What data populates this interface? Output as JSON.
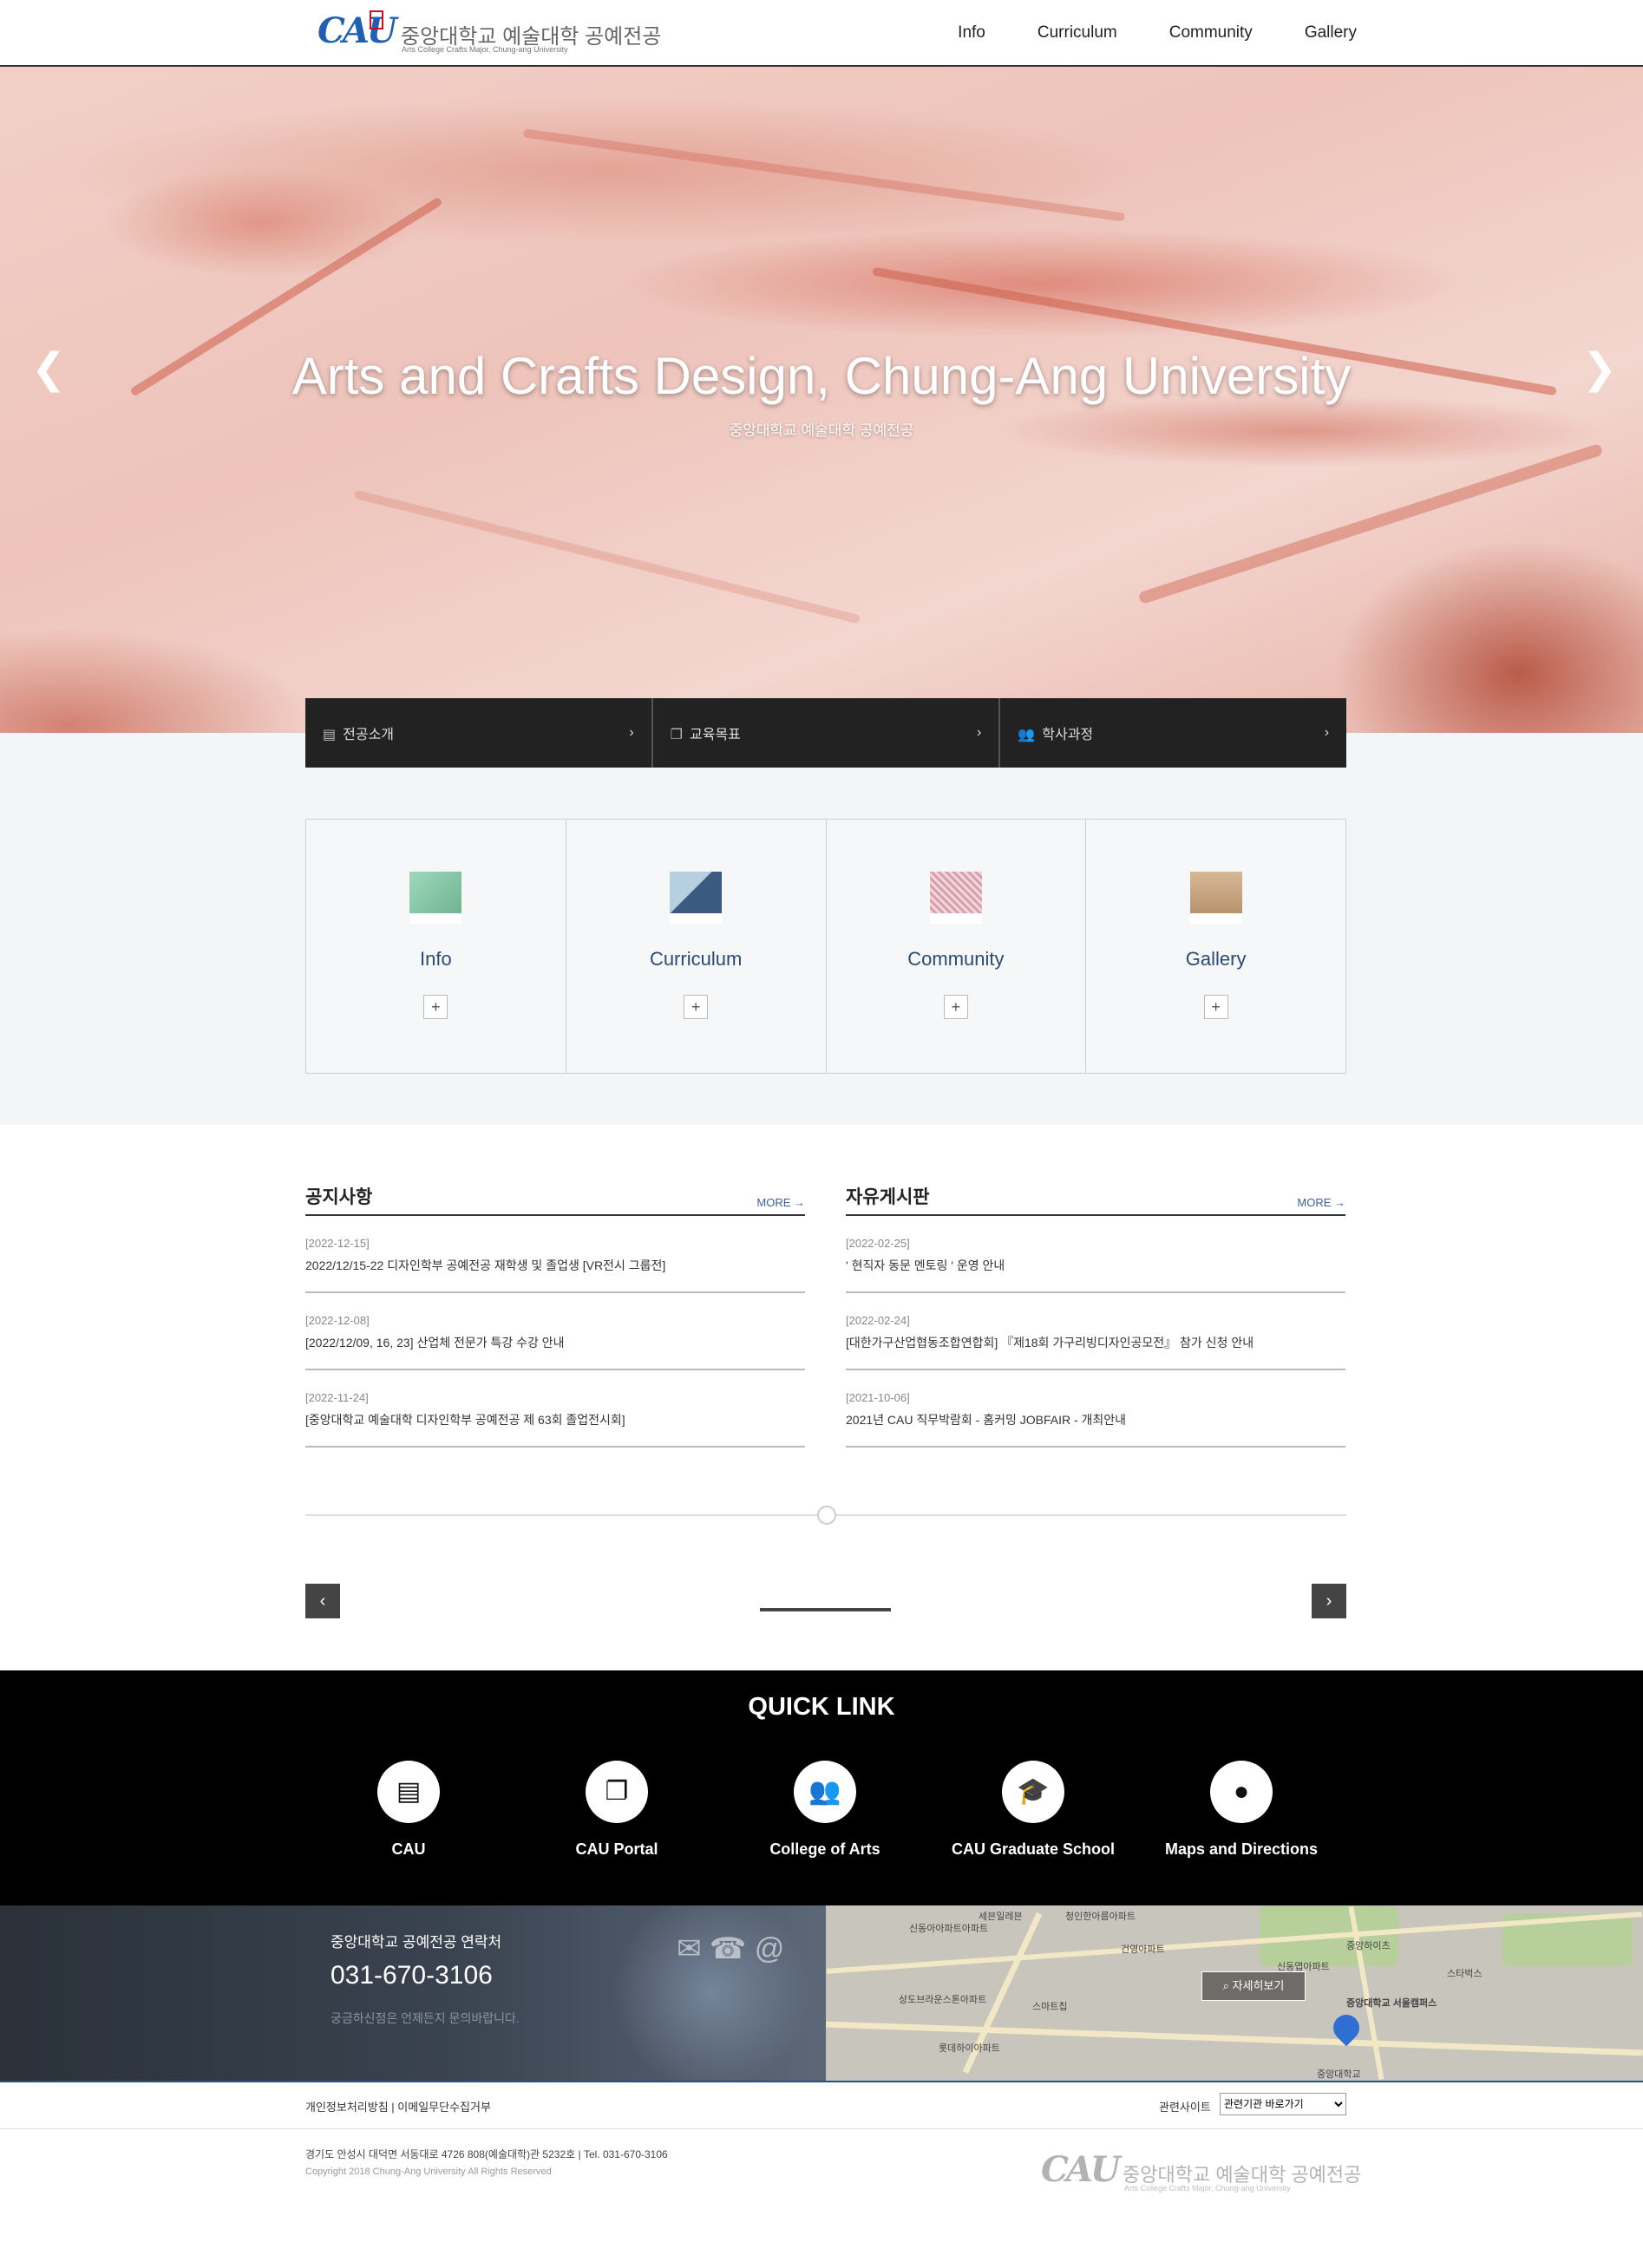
{
  "header": {
    "logo_mark": "CAU",
    "logo_kor": "중앙대학교 예술대학 공예전공",
    "logo_eng": "Arts College Crafts Major, Chung-ang University",
    "nav": [
      "Info",
      "Curriculum",
      "Community",
      "Gallery"
    ]
  },
  "hero": {
    "title": "Arts and Crafts Design, Chung-Ang University",
    "subtitle": "중앙대학교 예술대학 공예전공",
    "prev_icon": "chevron-left-icon",
    "next_icon": "chevron-right-icon"
  },
  "quickbar": [
    {
      "label": "전공소개",
      "icon": "book-icon"
    },
    {
      "label": "교육목표",
      "icon": "copy-icon"
    },
    {
      "label": "학사과정",
      "icon": "users-icon"
    }
  ],
  "cards": [
    {
      "label": "Info",
      "color": "#7fbfa0"
    },
    {
      "label": "Curriculum",
      "color": "#6b8fb0"
    },
    {
      "label": "Community",
      "color": "#d98a9a"
    },
    {
      "label": "Gallery",
      "color": "#c4a27f"
    }
  ],
  "boards": {
    "notice": {
      "title": "공지사항",
      "more": "MORE →",
      "items": [
        {
          "date": "[2022-12-15]",
          "title": "2022/12/15-22 디자인학부 공예전공 재학생 및 졸업생 [VR전시 그룹전]"
        },
        {
          "date": "[2022-12-08]",
          "title": "[2022/12/09, 16, 23] 산업체 전문가 특강 수강 안내"
        },
        {
          "date": "[2022-11-24]",
          "title": "[중앙대학교 예술대학 디자인학부 공예전공 제 63회 졸업전시회]"
        }
      ]
    },
    "free": {
      "title": "자유게시판",
      "more": "MORE →",
      "items": [
        {
          "date": "[2022-02-25]",
          "title": "' 현직자 동문 멘토링 ' 운영 안내"
        },
        {
          "date": "[2022-02-24]",
          "title": "[대한가구산업협동조합연합회] 『제18회 가구리빙디자인공모전』 참가 신청 안내"
        },
        {
          "date": "[2021-10-06]",
          "title": "2021년 CAU 직무박람회 - 홈커밍 JOBFAIR - 개최안내"
        }
      ]
    }
  },
  "slider": {
    "prev": "‹",
    "next": "›"
  },
  "quicklink": {
    "title": "QUICK LINK",
    "items": [
      {
        "label": "CAU",
        "icon": "book-icon",
        "glyph": "▤"
      },
      {
        "label": "CAU Portal",
        "icon": "copy-icon",
        "glyph": "❐"
      },
      {
        "label": "College of Arts",
        "icon": "users-icon",
        "glyph": "👥"
      },
      {
        "label": "CAU Graduate School",
        "icon": "graduation-cap-icon",
        "glyph": "🎓"
      },
      {
        "label": "Maps and Directions",
        "icon": "map-marker-icon",
        "glyph": "●"
      }
    ]
  },
  "contact": {
    "title": "중앙대학교 공예전공 연락처",
    "phone": "031-670-3106",
    "note": "궁금하신점은 언제든지 문의바랍니다."
  },
  "map": {
    "button": "자세히보기",
    "labels": [
      "세븐일레븐",
      "청인한아름아파트",
      "신동아아파트아파트",
      "건영아파트",
      "중앙하이츠",
      "신동엽아파트",
      "중앙대학교 서울캠퍼스",
      "스타벅스",
      "상도브라운스톤아파트",
      "스마트칩",
      "롯데하이아파트",
      "중앙대학교"
    ]
  },
  "footer": {
    "links": "개인정보처리방침  |  이메일무단수집거부",
    "related_label": "관련사이트",
    "related_select": "관련기관 바로가기",
    "address": "경기도 안성시 대덕면 서동대로 4726 808(예술대학)관 5232호  |  Tel. 031-670-3106",
    "copyright": "Copyright 2018 Chung-Ang University All Rights Reserved",
    "logo_mark": "CAU",
    "logo_kor": "중앙대학교 예술대학 공예전공",
    "logo_eng": "Arts College Crafts Major, Chung-ang University"
  }
}
